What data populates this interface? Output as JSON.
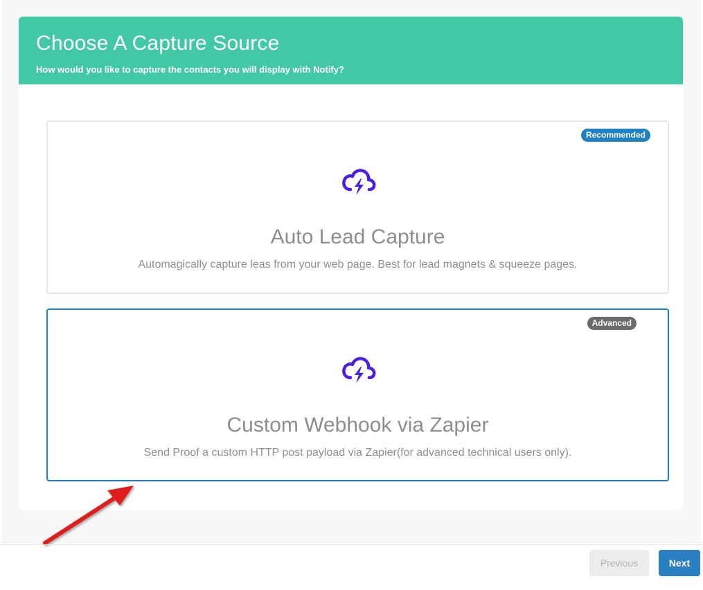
{
  "header": {
    "title": "Choose A Capture Source",
    "subtitle": "How would you like to capture the contacts you will display with Notify?"
  },
  "options": [
    {
      "badge": "Recommended",
      "icon": "cloud-lightning-icon",
      "title": "Auto Lead Capture",
      "description": "Automagically capture leas from your web page. Best for lead magnets & squeeze pages.",
      "selected": false
    },
    {
      "badge": "Advanced",
      "icon": "cloud-lightning-icon",
      "title": "Custom Webhook via Zapier",
      "description": "Send Proof a custom HTTP post payload via Zapier(for advanced technical users only).",
      "selected": true
    }
  ],
  "footer": {
    "previous_label": "Previous",
    "next_label": "Next"
  },
  "colors": {
    "header_bg": "#43c8a6",
    "icon": "#4b1fe0",
    "selected_border": "#1f80c4",
    "badge_recommended": "#1f80c4",
    "badge_advanced": "#6b6b6b",
    "next_button": "#2a7fc0",
    "annotation_arrow": "#e01b1b"
  }
}
